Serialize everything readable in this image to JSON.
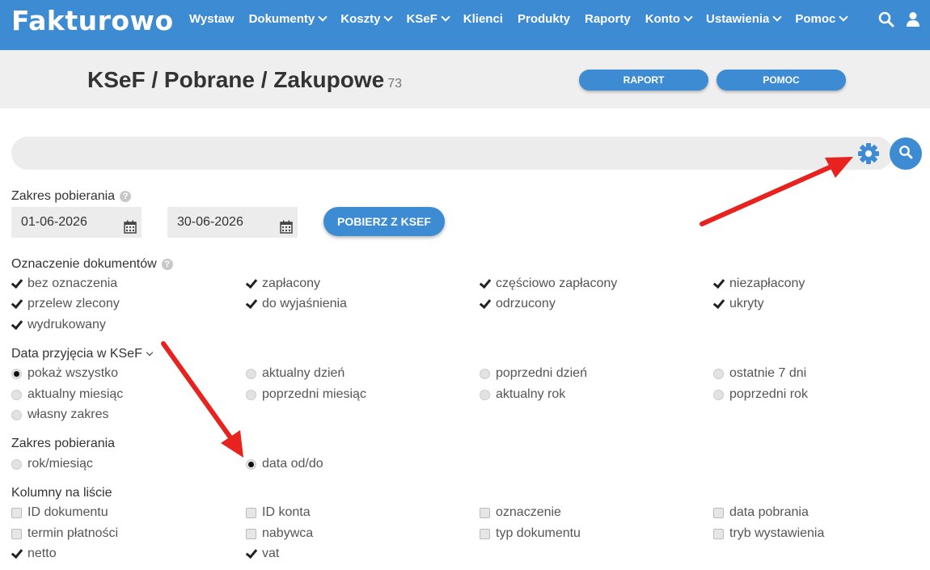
{
  "nav": {
    "logo": "Fakturowo",
    "items": [
      {
        "label": "Wystaw",
        "dropdown": false
      },
      {
        "label": "Dokumenty",
        "dropdown": true
      },
      {
        "label": "Koszty",
        "dropdown": true
      },
      {
        "label": "KSeF",
        "dropdown": true
      },
      {
        "label": "Klienci",
        "dropdown": false
      },
      {
        "label": "Produkty",
        "dropdown": false
      },
      {
        "label": "Raporty",
        "dropdown": false
      },
      {
        "label": "Konto",
        "dropdown": true
      },
      {
        "label": "Ustawienia",
        "dropdown": true
      },
      {
        "label": "Pomoc",
        "dropdown": true
      }
    ]
  },
  "header": {
    "title": "KSeF / Pobrane / Zakupowe",
    "count": "73",
    "raport_label": "RAPORT",
    "pomoc_label": "POMOC"
  },
  "range": {
    "label": "Zakres pobierania",
    "date_from": "01-06-2026",
    "date_to": "30-06-2026",
    "fetch_label": "POBIERZ Z KSEF"
  },
  "marking": {
    "label": "Oznaczenie dokumentów",
    "options": [
      {
        "label": "bez oznaczenia",
        "checked": true
      },
      {
        "label": "zapłacony",
        "checked": true
      },
      {
        "label": "częściowo zapłacony",
        "checked": true
      },
      {
        "label": "niezapłacony",
        "checked": true
      },
      {
        "label": "przelew zlecony",
        "checked": true
      },
      {
        "label": "do wyjaśnienia",
        "checked": true
      },
      {
        "label": "odrzucony",
        "checked": true
      },
      {
        "label": "ukryty",
        "checked": true
      },
      {
        "label": "wydrukowany",
        "checked": true
      }
    ]
  },
  "received": {
    "label": "Data przyjęcia w KSeF",
    "options": [
      {
        "label": "pokaż wszystko",
        "selected": true
      },
      {
        "label": "aktualny dzień",
        "selected": false
      },
      {
        "label": "poprzedni dzień",
        "selected": false
      },
      {
        "label": "ostatnie 7 dni",
        "selected": false
      },
      {
        "label": "aktualny miesiąc",
        "selected": false
      },
      {
        "label": "poprzedni miesiąc",
        "selected": false
      },
      {
        "label": "aktualny rok",
        "selected": false
      },
      {
        "label": "poprzedni rok",
        "selected": false
      },
      {
        "label": "własny zakres",
        "selected": false
      }
    ]
  },
  "range_mode": {
    "label": "Zakres pobierania",
    "options": [
      {
        "label": "rok/miesiąc",
        "selected": false
      },
      {
        "label": "data od/do",
        "selected": true
      }
    ]
  },
  "columns": {
    "label": "Kolumny na liście",
    "options": [
      {
        "label": "ID dokumentu",
        "checked": false
      },
      {
        "label": "ID konta",
        "checked": false
      },
      {
        "label": "oznaczenie",
        "checked": false
      },
      {
        "label": "data pobrania",
        "checked": false
      },
      {
        "label": "termin płatności",
        "checked": false
      },
      {
        "label": "nabywca",
        "checked": false
      },
      {
        "label": "typ dokumentu",
        "checked": false
      },
      {
        "label": "tryb wystawienia",
        "checked": false
      },
      {
        "label": "netto",
        "checked": true
      },
      {
        "label": "vat",
        "checked": true
      }
    ]
  },
  "colors": {
    "accent": "#3d8bd3",
    "arrow": "#e8221e"
  }
}
